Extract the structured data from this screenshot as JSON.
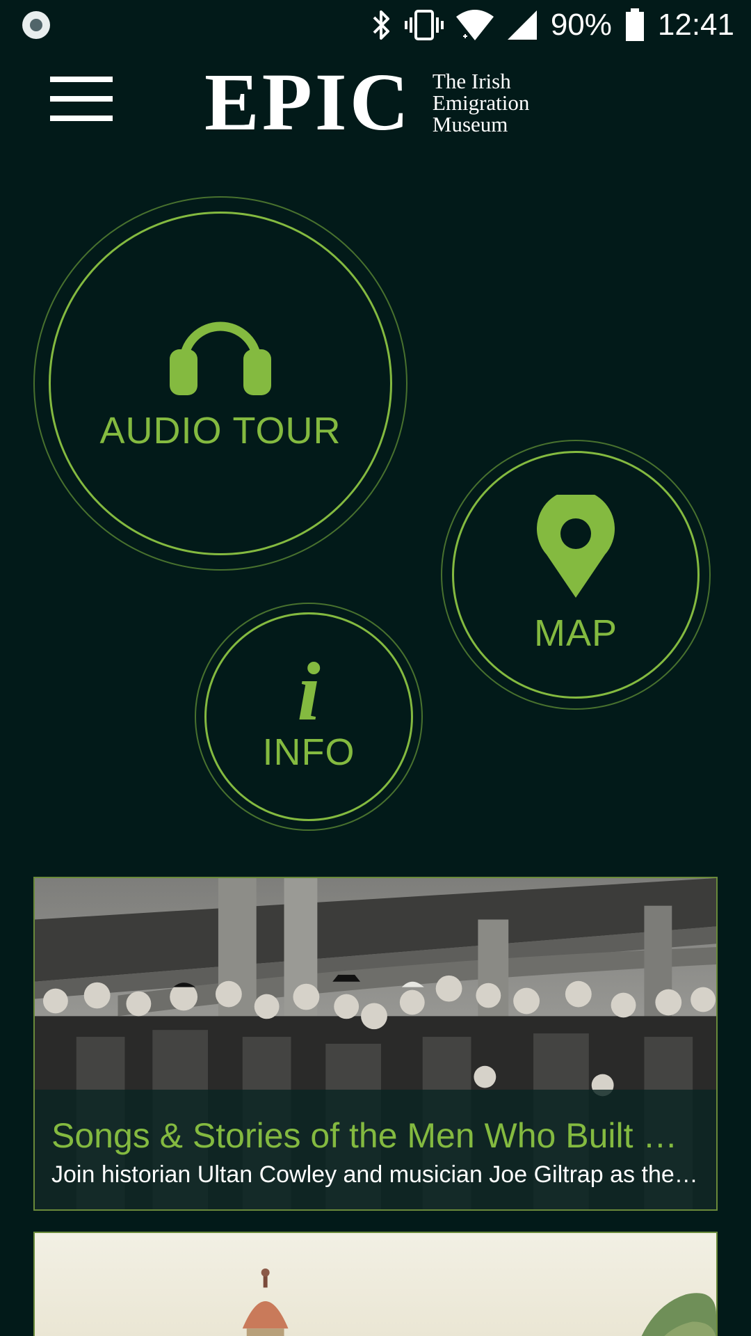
{
  "status_bar": {
    "battery_percent": "90%",
    "time": "12:41",
    "icons": [
      "notification-dot-icon",
      "bluetooth-icon",
      "vibrate-icon",
      "wifi-icon",
      "cellular-signal-icon",
      "battery-icon"
    ]
  },
  "header": {
    "menu_icon": "hamburger-menu-icon",
    "logo_main": "EPIC",
    "logo_sub_lines": [
      "The Irish",
      "Emigration",
      "Museum"
    ]
  },
  "nav_buttons": {
    "audio_tour": {
      "label": "AUDIO TOUR",
      "icon": "headphones-icon"
    },
    "map": {
      "label": "MAP",
      "icon": "map-pin-icon"
    },
    "info": {
      "label": "INFO",
      "icon": "info-icon",
      "glyph": "i"
    }
  },
  "cards": [
    {
      "title": "Songs & Stories of the Men Who Built Britain",
      "description": "Join historian Ultan Cowley and musician Joe Giltrap as they explore"
    },
    {
      "title": "",
      "description": ""
    }
  ],
  "colors": {
    "background": "#021a19",
    "accent": "#84ba40",
    "text_light": "#ffffff"
  }
}
